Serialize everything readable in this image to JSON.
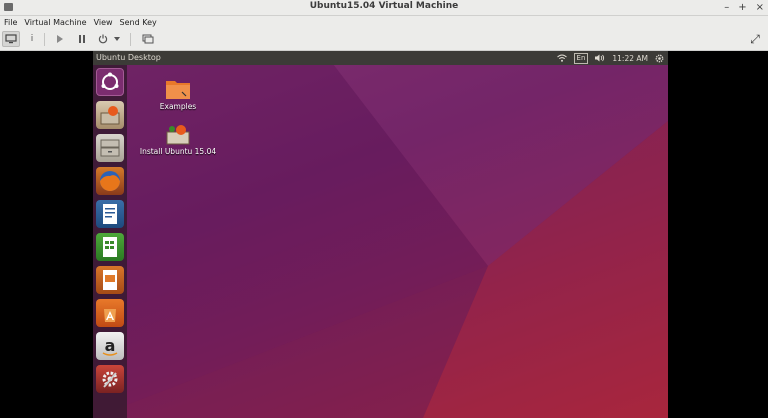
{
  "window": {
    "title": "Ubuntu15.04 Virtual Machine",
    "controls": [
      "–",
      "+",
      "×"
    ]
  },
  "menu": [
    "File",
    "Virtual Machine",
    "View",
    "Send Key"
  ],
  "toolbar": {
    "info_glyph": "i",
    "fullscreen_glyph": "⤢"
  },
  "guest": {
    "panel_title": "Ubuntu Desktop",
    "keyboard_layout": "En",
    "clock": "11:22 AM",
    "desktop_icons": [
      {
        "label": "Examples"
      },
      {
        "label": "Install Ubuntu 15.04"
      }
    ],
    "launcher_icons": [
      "ubuntu-dash-icon",
      "install-ubuntu-icon",
      "files-icon",
      "firefox-icon",
      "writer-icon",
      "calc-icon",
      "impress-icon",
      "software-center-icon",
      "amazon-icon",
      "system-settings-icon"
    ],
    "colors": {
      "panel": "#3c3b37",
      "wallpaper_top": "#6c1e62",
      "wallpaper_bottom": "#a5243f"
    }
  }
}
